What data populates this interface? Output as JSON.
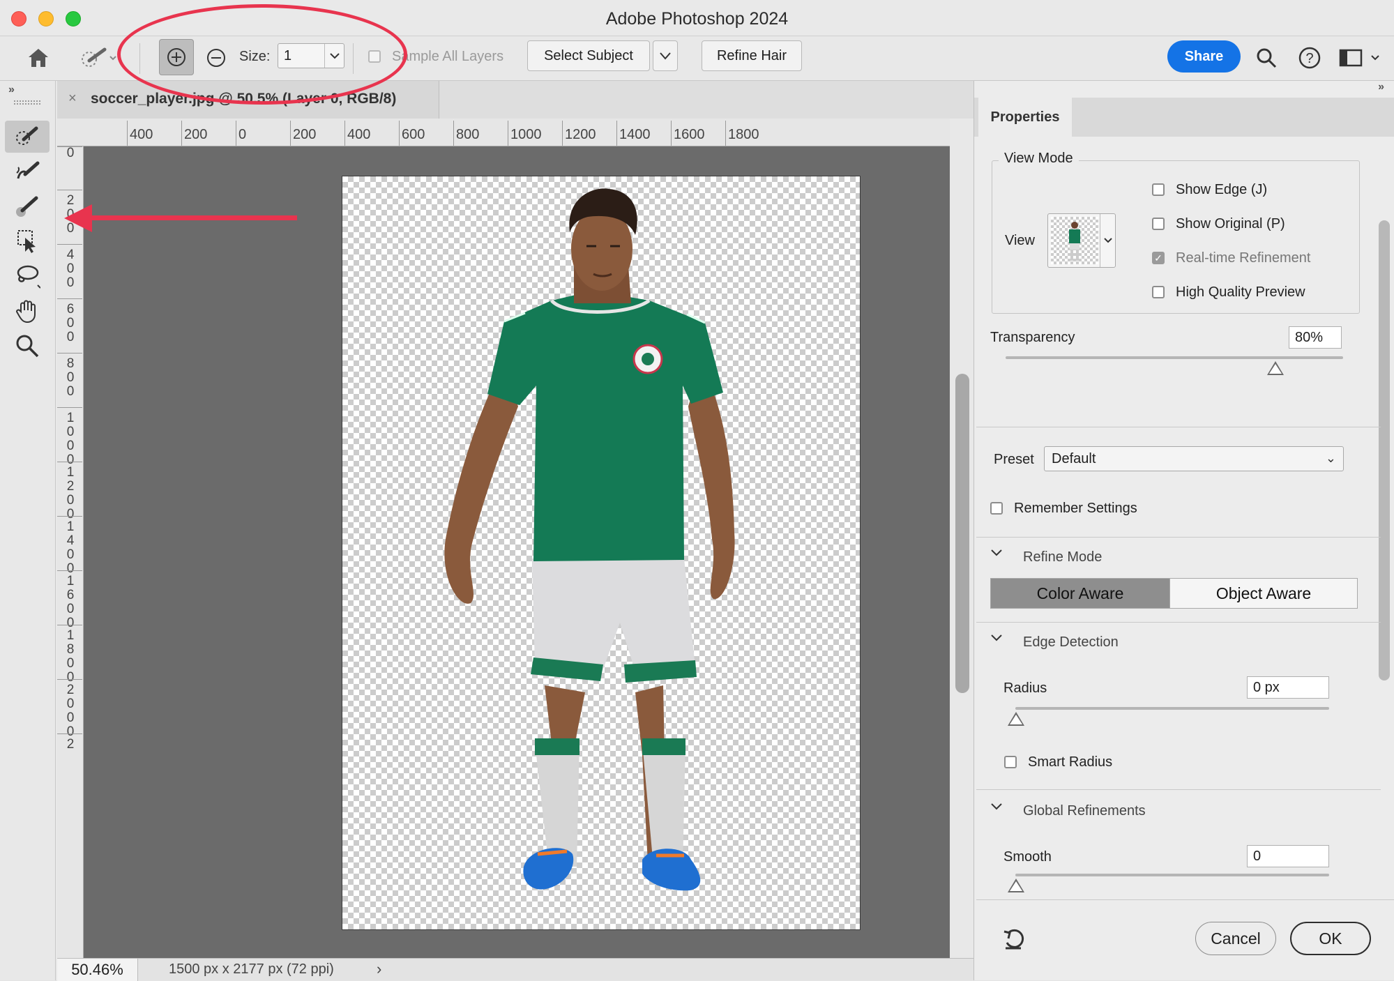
{
  "window": {
    "title": "Adobe Photoshop 2024"
  },
  "options_bar": {
    "size_label": "Size:",
    "size_value": "1",
    "sample_all_layers": "Sample All Layers",
    "select_subject": "Select Subject",
    "refine_hair": "Refine Hair",
    "share": "Share"
  },
  "document": {
    "tab_name": "soccer_player.jpg @ 50.5% (Layer 0, RGB/8)",
    "zoom": "50.46%",
    "info": "1500 px x 2177 px (72 ppi)"
  },
  "rulers": {
    "horizontal": [
      "400",
      "200",
      "0",
      "200",
      "400",
      "600",
      "800",
      "1000",
      "1200",
      "1400",
      "1600",
      "1800"
    ],
    "vertical": [
      "0",
      "200",
      "400",
      "600",
      "800",
      "1000",
      "1200",
      "1400",
      "1600",
      "1800",
      "2000",
      "2"
    ]
  },
  "properties": {
    "tab": "Properties",
    "view_mode": {
      "legend": "View Mode",
      "view_label": "View",
      "show_edge": "Show Edge (J)",
      "show_original": "Show Original (P)",
      "realtime_refinement": "Real-time Refinement",
      "high_quality_preview": "High Quality Preview"
    },
    "transparency": {
      "label": "Transparency",
      "value": "80%",
      "level": 0.8
    },
    "preset": {
      "label": "Preset",
      "value": "Default"
    },
    "remember_settings": "Remember Settings",
    "refine_mode": {
      "label": "Refine Mode",
      "color_aware": "Color Aware",
      "object_aware": "Object Aware",
      "selected": "Color Aware"
    },
    "edge_detection": {
      "label": "Edge Detection",
      "radius_label": "Radius",
      "radius_value": "0 px",
      "smart_radius": "Smart Radius"
    },
    "global_refinements": {
      "label": "Global Refinements",
      "smooth_label": "Smooth",
      "smooth_value": "0"
    },
    "cancel": "Cancel",
    "ok": "OK"
  },
  "icons": [
    "home-icon",
    "quick-selection-tool-icon",
    "add-to-selection-icon",
    "subtract-from-selection-icon",
    "search-icon",
    "help-icon",
    "workspace-icon",
    "refine-edge-brush-icon",
    "brush-icon",
    "object-selection-icon",
    "lasso-icon",
    "hand-icon",
    "zoom-icon",
    "reset-icon"
  ],
  "colors": {
    "accent": "#1473e6",
    "annotation": "#e8344e",
    "jersey": "#147a55"
  }
}
